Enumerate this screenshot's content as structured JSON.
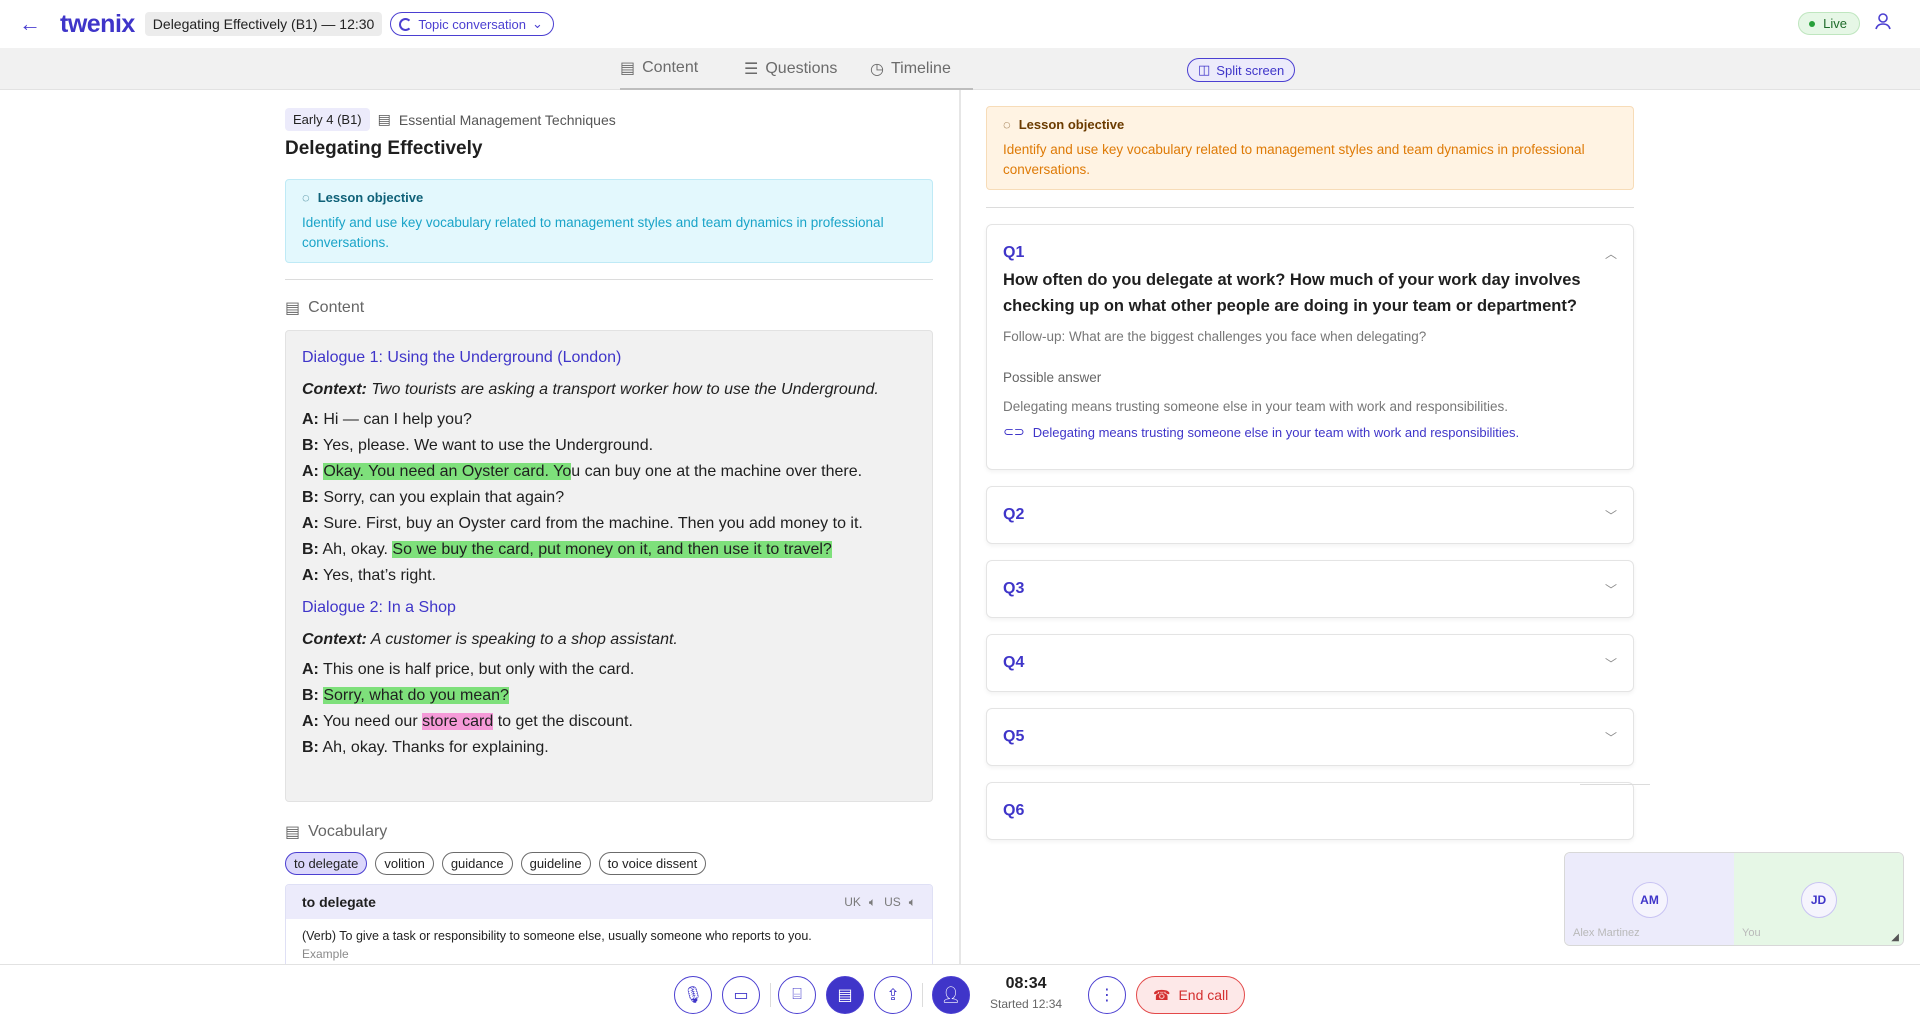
{
  "header": {
    "logo": "twenix",
    "lesson_chip": "Delegating Effectively (B1) — 12:30",
    "mode_label": "Topic conversation",
    "live_label": "Live"
  },
  "tabs": [
    {
      "label": "Content"
    },
    {
      "label": "Questions"
    },
    {
      "label": "Timeline"
    }
  ],
  "split_label": "Split screen",
  "lesson": {
    "level": "Early 4 (B1)",
    "course": "Essential Management Techniques",
    "title": "Delegating Effectively",
    "objective_heading": "Lesson objective",
    "objective_text": "Identify and use key vocabulary related to management styles and team dynamics in professional conversations."
  },
  "content": {
    "section_label": "Content",
    "dialogues": [
      {
        "title": "Dialogue 1: Using the Underground (London)",
        "context_label": "Context:",
        "context_text": "Two tourists are asking a transport worker how to use the Underground."
      },
      {
        "title": "Dialogue 2: In a Shop",
        "context_label": "Context:",
        "context_text": "A customer is speaking to a shop assistant."
      }
    ],
    "d1_lines": [
      {
        "sp": "A:",
        "pre": "Hi — can I help you?",
        "hl": "",
        "post": ""
      },
      {
        "sp": "B:",
        "pre": "Yes, please. We want to use the Underground.",
        "hl": "",
        "post": ""
      },
      {
        "sp": "A:",
        "pre": "",
        "hl": "Okay. You need an Oyster card. Yo",
        "post": "u can buy one at the machine over there."
      },
      {
        "sp": "B:",
        "pre": "Sorry, can you explain that again?",
        "hl": "",
        "post": ""
      },
      {
        "sp": "A:",
        "pre": "Sure. First, buy an Oyster card from the machine. Then you add money to it.",
        "hl": "",
        "post": ""
      },
      {
        "sp": "B:",
        "pre": "Ah, okay. ",
        "hl": "So we buy the card, put money on it, and then use it to travel?",
        "post": ""
      },
      {
        "sp": "A:",
        "pre": "Yes, that’s right.",
        "hl": "",
        "post": ""
      }
    ],
    "d2_lines": [
      {
        "sp": "A:",
        "pre": "This one is half price, but only with the card.",
        "hl": "",
        "post": ""
      },
      {
        "sp": "B:",
        "pre": "",
        "hl": "Sorry, what do you mean?",
        "post": ""
      },
      {
        "sp": "A:",
        "pre": "You need our ",
        "hl": "store card",
        "post": " to get the discount."
      },
      {
        "sp": "B:",
        "pre": "Ah, okay. Thanks for explaining.",
        "hl": "",
        "post": ""
      }
    ]
  },
  "vocabulary": {
    "section_label": "Vocabulary",
    "chips": [
      "to delegate",
      "volition",
      "guidance",
      "guideline",
      "to voice dissent"
    ],
    "selected": {
      "word": "to delegate",
      "uk": "UK",
      "us": "US",
      "definition": "(Verb) To give a task or responsibility to someone else, usually someone who reports to you.",
      "example_label": "Example"
    }
  },
  "questions": {
    "objective_heading": "Lesson objective",
    "objective_text": "Identify and use key vocabulary related to management styles and team dynamics in professional conversations.",
    "q1": {
      "label": "Q1",
      "question": "How often do you delegate at work? How much of your work day involves checking up on what other people are doing in your team or department?",
      "followup": "Follow-up: What are the biggest challenges you face when delegating?",
      "possible_answer_heading": "Possible answer",
      "possible_answer": "Delegating means trusting someone else in your team with work and responsibilities.",
      "link_text": "Delegating means trusting someone else in your team with work and responsibilities."
    },
    "collapsed": [
      "Q2",
      "Q3",
      "Q4",
      "Q5",
      "Q6"
    ]
  },
  "video": {
    "tiles": [
      {
        "initials": "AM",
        "name": "Alex Martinez"
      },
      {
        "initials": "JD",
        "name": "You"
      }
    ]
  },
  "call": {
    "timer": "08:34",
    "started": "Started 12:34",
    "end_label": "End call"
  },
  "colors": {
    "brand": "#3f35c9",
    "highlight_green": "#7ee07b",
    "highlight_pink": "#f59ad8",
    "end_call_red": "#d42f2f"
  }
}
